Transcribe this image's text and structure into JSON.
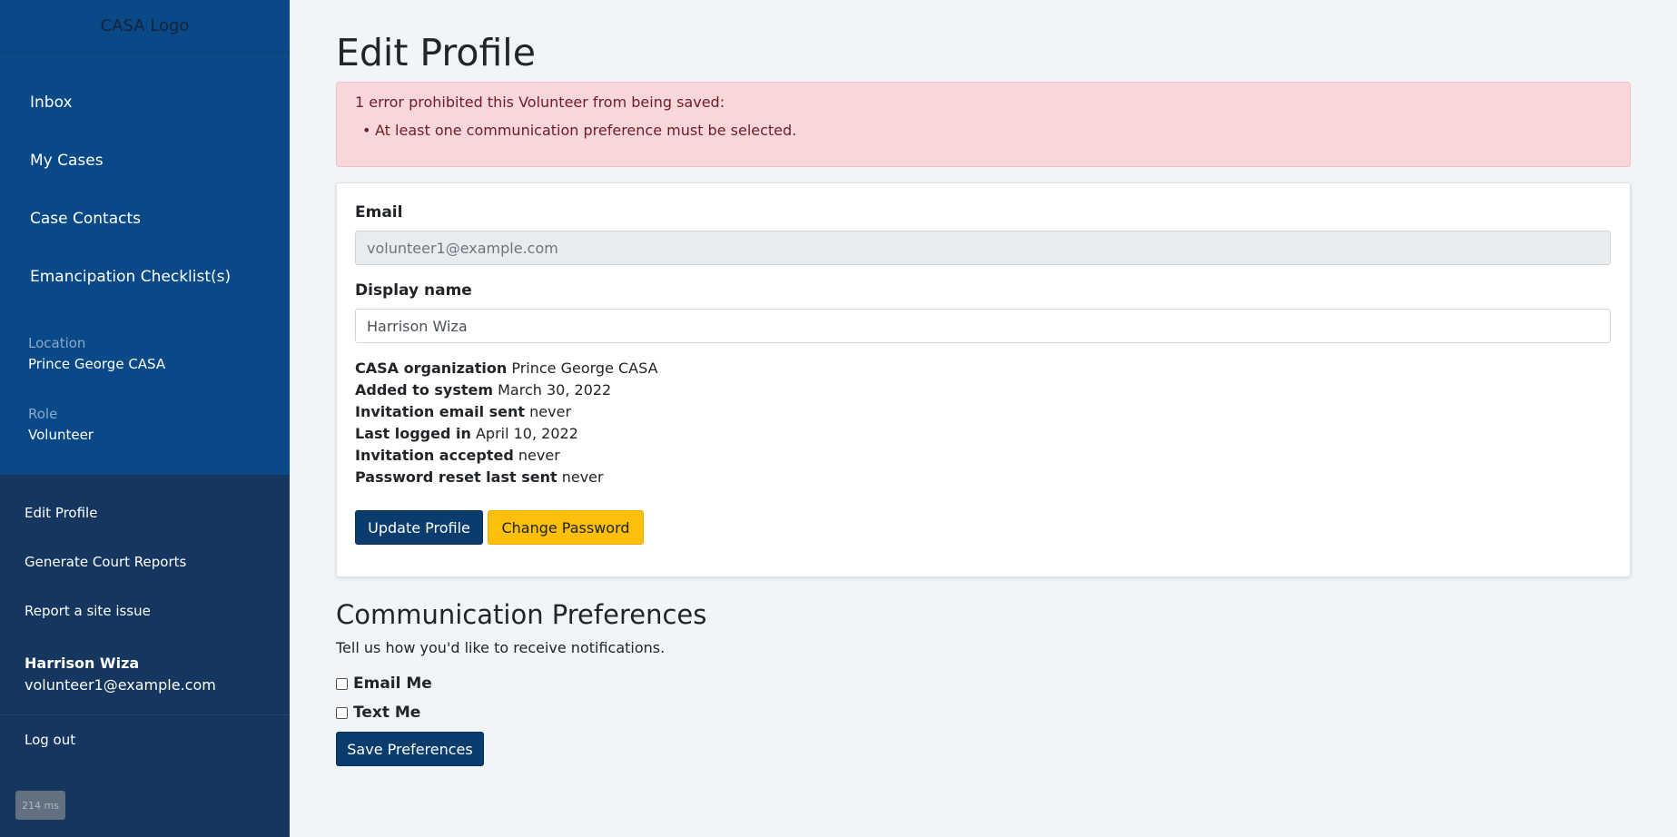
{
  "sidebar": {
    "logo_text": "CASA Logo",
    "nav": [
      "Inbox",
      "My Cases",
      "Case Contacts",
      "Emancipation Checklist(s)"
    ],
    "location_label": "Location",
    "location_value": "Prince George CASA",
    "role_label": "Role",
    "role_value": "Volunteer",
    "links": [
      "Edit Profile",
      "Generate Court Reports",
      "Report a site issue"
    ],
    "user_name": "Harrison Wiza",
    "user_email": "volunteer1@example.com",
    "logout": "Log out",
    "timing": "214 ms"
  },
  "main": {
    "title": "Edit Profile",
    "alert": {
      "title": "1 error prohibited this Volunteer from being saved:",
      "item": "At least one communication preference must be selected."
    },
    "form": {
      "email_label": "Email",
      "email_value": "volunteer1@example.com",
      "display_name_label": "Display name",
      "display_name_value": "Harrison Wiza",
      "info": [
        {
          "label": "CASA organization",
          "value": "Prince George CASA"
        },
        {
          "label": "Added to system",
          "value": "March 30, 2022"
        },
        {
          "label": "Invitation email sent",
          "value": "never"
        },
        {
          "label": "Last logged in",
          "value": "April 10, 2022"
        },
        {
          "label": "Invitation accepted",
          "value": "never"
        },
        {
          "label": "Password reset last sent",
          "value": "never"
        }
      ],
      "update_button": "Update Profile",
      "password_button": "Change Password"
    },
    "prefs": {
      "title": "Communication Preferences",
      "subtitle": "Tell us how you'd like to receive notifications.",
      "options": [
        "Email Me",
        "Text Me"
      ],
      "save_button": "Save Preferences"
    }
  },
  "colors": {
    "sidebar_top": "#0a4987",
    "sidebar_bottom": "#14365f",
    "primary": "#0a3d6e",
    "warning": "#fcbf0b",
    "alert_bg": "#f7d7da"
  }
}
